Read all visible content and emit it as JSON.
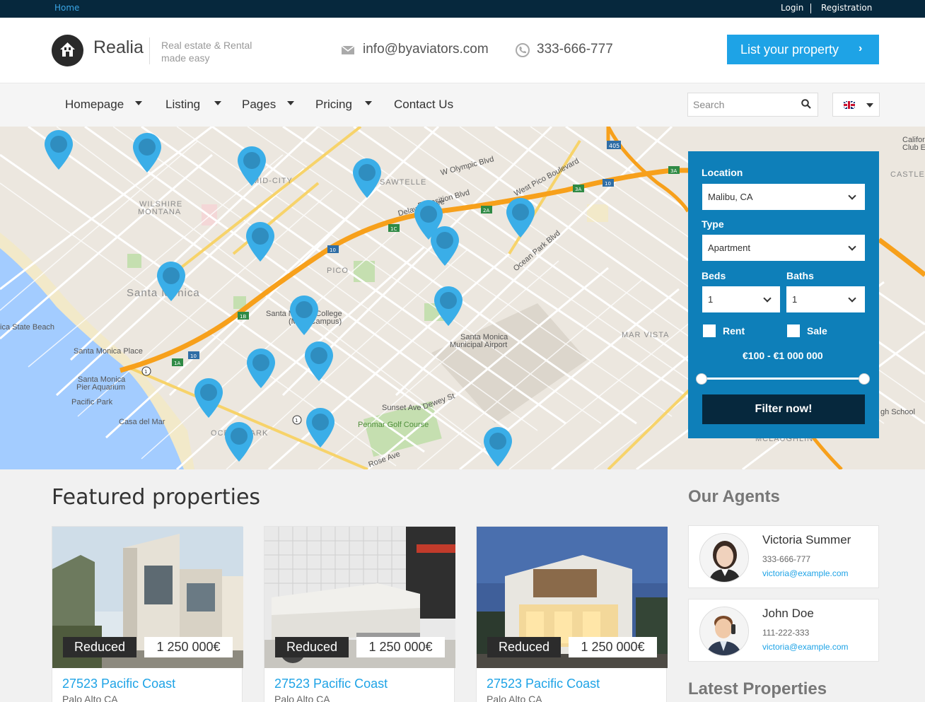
{
  "topbar": {
    "home": "Home",
    "login": "Login",
    "registration": "Registration"
  },
  "header": {
    "brand": "Realia",
    "tagline": "Real estate & Rental made easy",
    "email": "info@byaviators.com",
    "phone": "333-666-777",
    "list_button": "List your property",
    "list_button_icon": "chevron-right-icon"
  },
  "nav": {
    "items": [
      {
        "label": "Homepage",
        "dropdown": true
      },
      {
        "label": "Listing",
        "dropdown": true
      },
      {
        "label": "Pages",
        "dropdown": true
      },
      {
        "label": "Pricing",
        "dropdown": true
      },
      {
        "label": "Contact Us",
        "dropdown": false
      }
    ],
    "search_placeholder": "Search",
    "language": "uk-flag-icon"
  },
  "map": {
    "labels": {
      "santa_monica": "Santa Monica",
      "wilshire": "WILSHIRE",
      "montana": "MONTANA",
      "mid_city": "MID-CITY",
      "sawtelle": "SAWTELLE",
      "pico": "PICO",
      "mar_vista": "MAR VISTA",
      "ocean_park": "OCEAN PARK",
      "castle": "CASTLE",
      "mclaughlin": "MCLAUGHLIN",
      "sm_college": "Santa Monica College",
      "main_campus": "(Main Campus)",
      "sm_place": "Santa Monica Place",
      "pier": "Santa Monica",
      "pier_aquarium": "Pier Aquarium",
      "pacific_park": "Pacific Park",
      "casa_del_mar": "Casa del Mar",
      "state_beach": "ica State Beach",
      "airport": "Santa Monica",
      "airport2": "Municipal Airport",
      "penmar": "Penmar Golf Course",
      "sunset": "Sunset Ave",
      "dewey": "Dewey St",
      "rose": "Rose Ave",
      "w_olympic": "W Olympic Blvd",
      "exposition": "Exposition Blvd",
      "delaware": "Delaware Ave",
      "west_pico": "West Pico Boulevard",
      "ocean_park_blvd": "Ocean Park Blvd",
      "high_school": "gh School",
      "california": "Califor",
      "club": "Club E"
    },
    "pins": 19
  },
  "filter": {
    "location_label": "Location",
    "location_value": "Malibu, CA",
    "type_label": "Type",
    "type_value": "Apartment",
    "beds_label": "Beds",
    "beds_value": "1",
    "baths_label": "Baths",
    "baths_value": "1",
    "rent_label": "Rent",
    "sale_label": "Sale",
    "price_range": "€100 - €1 000 000",
    "button": "Filter now!"
  },
  "featured": {
    "title": "Featured properties",
    "cards": [
      {
        "badge": "Reduced",
        "price": "1 250 000€",
        "title": "27523 Pacific Coast",
        "location": "Palo Alto CA"
      },
      {
        "badge": "Reduced",
        "price": "1 250 000€",
        "title": "27523 Pacific Coast",
        "location": "Palo Alto CA"
      },
      {
        "badge": "Reduced",
        "price": "1 250 000€",
        "title": "27523 Pacific Coast",
        "location": "Palo Alto CA"
      }
    ]
  },
  "agents": {
    "title": "Our Agents",
    "list": [
      {
        "name": "Victoria Summer",
        "phone": "333-666-777",
        "email": "victoria@example.com"
      },
      {
        "name": "John Doe",
        "phone": "111-222-333",
        "email": "victoria@example.com"
      }
    ]
  },
  "latest": {
    "title": "Latest Properties"
  },
  "colors": {
    "accent": "#1ea3e6",
    "topbar": "#06283d",
    "filter_panel": "#0e7fb9",
    "pin": "#3aaee8"
  }
}
